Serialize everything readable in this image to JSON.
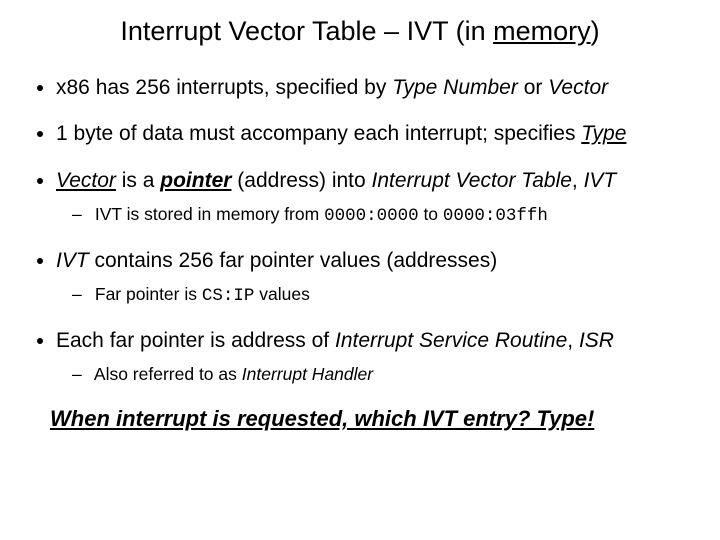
{
  "title_pre": "Interrupt Vector Table – IVT (in ",
  "title_mem": "memory",
  "title_post": ")",
  "b1_a": "x86 has 256 interrupts, specified by ",
  "b1_tn": "Type Number",
  "b1_or": " or ",
  "b1_vec": "Vector",
  "b2_a": "1 byte of data must accompany each interrupt; specifies ",
  "b2_type": "Type",
  "b3_vec": "Vector",
  "b3_mid": " is a ",
  "b3_ptr": "pointer",
  "b3_into": " (address) into ",
  "b3_ivt": "Interrupt Vector Table",
  "b3_comma": ", ",
  "b3_short": "IVT",
  "b3s_a": "IVT is stored in memory from ",
  "b3s_r1": "0000:0000",
  "b3s_to": " to ",
  "b3s_r2": "0000:03ffh",
  "b4_ivt": "IVT",
  "b4_rest": " contains 256 far pointer values (addresses)",
  "b4s_a": "Far pointer is ",
  "b4s_csip": "CS:IP",
  "b4s_b": " values",
  "b5_a": "Each far pointer is address of ",
  "b5_isr": "Interrupt Service Routine",
  "b5_comma": ", ",
  "b5_short": "ISR",
  "b5s_a": "Also referred to as ",
  "b5s_ih": "Interrupt Handler",
  "closing": "When interrupt is requested, which IVT entry?  Type!"
}
